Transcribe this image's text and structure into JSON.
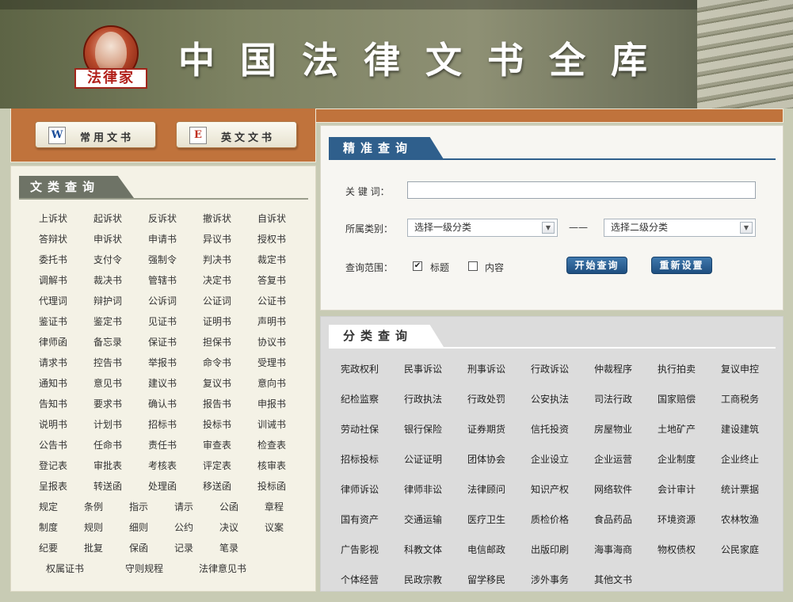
{
  "header": {
    "logo_text": "法律家",
    "title": "中国法律文书全库"
  },
  "buttons": {
    "common": {
      "icon": "W",
      "label": "常用文书"
    },
    "english": {
      "icon": "E",
      "label": "英文文书"
    }
  },
  "left_panel": {
    "tab_label": "文类查询",
    "grid_items": [
      "上诉状",
      "起诉状",
      "反诉状",
      "撤诉状",
      "自诉状",
      "答辩状",
      "申诉状",
      "申请书",
      "异议书",
      "授权书",
      "委托书",
      "支付令",
      "强制令",
      "判决书",
      "裁定书",
      "调解书",
      "裁决书",
      "管辖书",
      "决定书",
      "答复书",
      "代理词",
      "辩护词",
      "公诉词",
      "公证词",
      "公证书",
      "鉴证书",
      "鉴定书",
      "见证书",
      "证明书",
      "声明书",
      "律师函",
      "备忘录",
      "保证书",
      "担保书",
      "协议书",
      "请求书",
      "控告书",
      "举报书",
      "命令书",
      "受理书",
      "通知书",
      "意见书",
      "建议书",
      "复议书",
      "意向书",
      "告知书",
      "要求书",
      "确认书",
      "报告书",
      "申报书",
      "说明书",
      "计划书",
      "招标书",
      "投标书",
      "训诫书",
      "公告书",
      "任命书",
      "责任书",
      "审查表",
      "检查表",
      "登记表",
      "审批表",
      "考核表",
      "评定表",
      "核审表",
      "呈报表",
      "转送函",
      "处理函",
      "移送函",
      "投标函"
    ],
    "row_items": [
      [
        "规定",
        "条例",
        "指示",
        "请示",
        "公函",
        "章程"
      ],
      [
        "制度",
        "规则",
        "细则",
        "公约",
        "决议",
        "议案"
      ],
      [
        "纪要",
        "批复",
        "保函",
        "记录",
        "笔录"
      ]
    ],
    "last_row": [
      "权属证书",
      "守则规程",
      "法律意见书"
    ]
  },
  "precise_search": {
    "tab_label": "精准查询",
    "keyword_label": "关 键 词：",
    "keyword_value": "",
    "category_label": "所属类别：",
    "select1": "选择一级分类",
    "select2": "选择二级分类",
    "separator": "——",
    "scope_label": "查询范围：",
    "scope_title": "标题",
    "scope_title_checked": "✔",
    "scope_content": "内容",
    "search_button": "开始查询",
    "reset_button": "重新设置"
  },
  "class_search": {
    "tab_label": "分类查询",
    "items": [
      "宪政权利",
      "民事诉讼",
      "刑事诉讼",
      "行政诉讼",
      "仲裁程序",
      "执行拍卖",
      "复议申控",
      "纪检监察",
      "行政执法",
      "行政处罚",
      "公安执法",
      "司法行政",
      "国家赔偿",
      "工商税务",
      "劳动社保",
      "银行保险",
      "证券期货",
      "信托投资",
      "房屋物业",
      "土地矿产",
      "建设建筑",
      "招标投标",
      "公证证明",
      "团体协会",
      "企业设立",
      "企业运营",
      "企业制度",
      "企业终止",
      "律师诉讼",
      "律师非讼",
      "法律顾问",
      "知识产权",
      "网络软件",
      "会计审计",
      "统计票据",
      "国有资产",
      "交通运输",
      "医疗卫生",
      "质检价格",
      "食品药品",
      "环境资源",
      "农林牧渔",
      "广告影视",
      "科教文体",
      "电信邮政",
      "出版印刷",
      "海事海商",
      "物权债权",
      "公民家庭",
      "个体经营",
      "民政宗教",
      "留学移民",
      "涉外事务",
      "其他文书"
    ]
  }
}
